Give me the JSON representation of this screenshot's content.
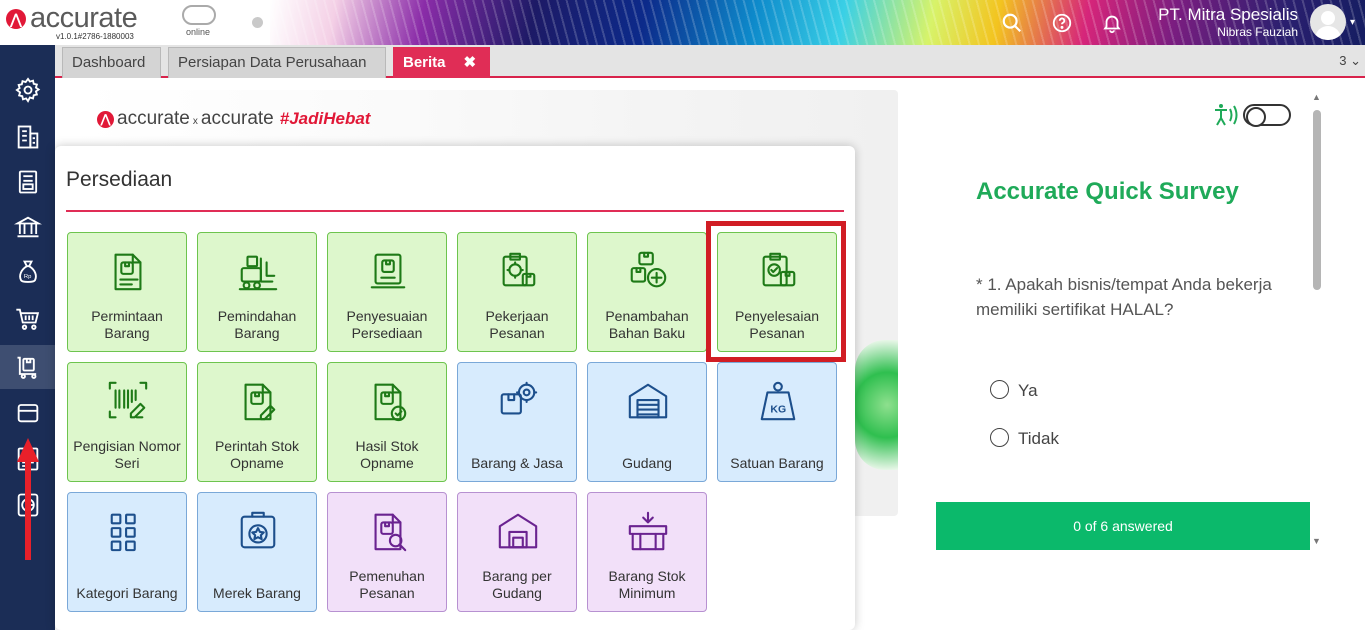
{
  "header": {
    "logo_text": "accurate",
    "logo_sub": "online",
    "version": "v1.0.1#2786-1880003",
    "company": "PT. Mitra Spesialis",
    "user": "Nibras Fauziah"
  },
  "tabs": [
    {
      "label": "Dashboard"
    },
    {
      "label": "Persiapan Data Perusahaan"
    },
    {
      "label": "Berita",
      "close": "✖"
    }
  ],
  "tab_count": "3",
  "tab_count_chevron": "⌄",
  "banner": {
    "brand_left": "accurate",
    "brand_x": "x",
    "brand_right": "accurate",
    "tag": "#JadiHebat"
  },
  "survey": {
    "title": "Accurate Quick Survey",
    "question": "* 1. Apakah bisnis/tempat Anda bekerja memiliki sertifikat HALAL?",
    "options": [
      "Ya",
      "Tidak"
    ],
    "progress": "0 of 6 answered",
    "accessibility_toggle": false
  },
  "panel": {
    "title": "Persediaan",
    "tiles": [
      {
        "label": "Permintaan Barang",
        "icon": "request-item-icon",
        "color": "green"
      },
      {
        "label": "Pemindahan Barang",
        "icon": "forklift-icon",
        "color": "green"
      },
      {
        "label": "Penyesuaian Persediaan",
        "icon": "adjust-stock-icon",
        "color": "green"
      },
      {
        "label": "Pekerjaan Pesanan",
        "icon": "work-order-icon",
        "color": "green"
      },
      {
        "label": "Penambahan Bahan Baku",
        "icon": "add-material-icon",
        "color": "green"
      },
      {
        "label": "Penyelesaian Pesanan",
        "icon": "order-completion-icon",
        "color": "green"
      },
      {
        "label": "Pengisian Nomor Seri",
        "icon": "barcode-icon",
        "color": "green"
      },
      {
        "label": "Perintah Stok Opname",
        "icon": "stock-opname-order-icon",
        "color": "green"
      },
      {
        "label": "Hasil Stok Opname",
        "icon": "stock-opname-result-icon",
        "color": "green"
      },
      {
        "label": "Barang & Jasa",
        "icon": "item-service-icon",
        "color": "blue"
      },
      {
        "label": "Gudang",
        "icon": "warehouse-icon",
        "color": "blue"
      },
      {
        "label": "Satuan Barang",
        "icon": "weight-kg-icon",
        "color": "blue"
      },
      {
        "label": "Kategori Barang",
        "icon": "category-icon",
        "color": "blue"
      },
      {
        "label": "Merek Barang",
        "icon": "brand-badge-icon",
        "color": "blue"
      },
      {
        "label": "Pemenuhan Pesanan",
        "icon": "order-fulfillment-icon",
        "color": "purple"
      },
      {
        "label": "Barang per Gudang",
        "icon": "items-per-warehouse-icon",
        "color": "purple"
      },
      {
        "label": "Barang Stok Minimum",
        "icon": "minimum-stock-icon",
        "color": "purple"
      }
    ]
  },
  "colors": {
    "accent": "#e02d56",
    "sidebar": "#1b2d56",
    "tile_green": "#ddf7cc",
    "tile_blue": "#d7ebfd",
    "tile_purple": "#f2e0f9",
    "survey_green": "#0bb96b",
    "highlight": "#d11d24"
  }
}
